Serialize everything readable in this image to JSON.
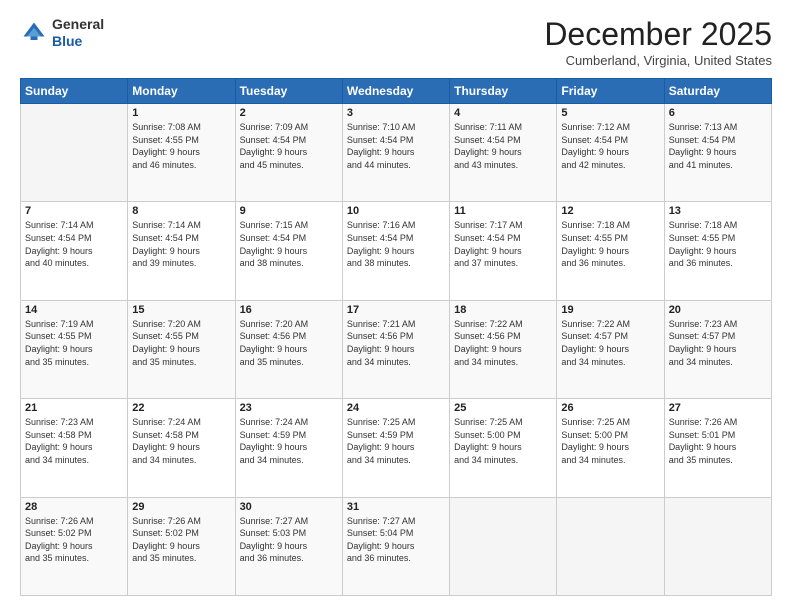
{
  "header": {
    "logo_general": "General",
    "logo_blue": "Blue",
    "month_title": "December 2025",
    "location": "Cumberland, Virginia, United States"
  },
  "weekdays": [
    "Sunday",
    "Monday",
    "Tuesday",
    "Wednesday",
    "Thursday",
    "Friday",
    "Saturday"
  ],
  "weeks": [
    [
      {
        "day": "",
        "info": ""
      },
      {
        "day": "1",
        "info": "Sunrise: 7:08 AM\nSunset: 4:55 PM\nDaylight: 9 hours\nand 46 minutes."
      },
      {
        "day": "2",
        "info": "Sunrise: 7:09 AM\nSunset: 4:54 PM\nDaylight: 9 hours\nand 45 minutes."
      },
      {
        "day": "3",
        "info": "Sunrise: 7:10 AM\nSunset: 4:54 PM\nDaylight: 9 hours\nand 44 minutes."
      },
      {
        "day": "4",
        "info": "Sunrise: 7:11 AM\nSunset: 4:54 PM\nDaylight: 9 hours\nand 43 minutes."
      },
      {
        "day": "5",
        "info": "Sunrise: 7:12 AM\nSunset: 4:54 PM\nDaylight: 9 hours\nand 42 minutes."
      },
      {
        "day": "6",
        "info": "Sunrise: 7:13 AM\nSunset: 4:54 PM\nDaylight: 9 hours\nand 41 minutes."
      }
    ],
    [
      {
        "day": "7",
        "info": "Sunrise: 7:14 AM\nSunset: 4:54 PM\nDaylight: 9 hours\nand 40 minutes."
      },
      {
        "day": "8",
        "info": "Sunrise: 7:14 AM\nSunset: 4:54 PM\nDaylight: 9 hours\nand 39 minutes."
      },
      {
        "day": "9",
        "info": "Sunrise: 7:15 AM\nSunset: 4:54 PM\nDaylight: 9 hours\nand 38 minutes."
      },
      {
        "day": "10",
        "info": "Sunrise: 7:16 AM\nSunset: 4:54 PM\nDaylight: 9 hours\nand 38 minutes."
      },
      {
        "day": "11",
        "info": "Sunrise: 7:17 AM\nSunset: 4:54 PM\nDaylight: 9 hours\nand 37 minutes."
      },
      {
        "day": "12",
        "info": "Sunrise: 7:18 AM\nSunset: 4:55 PM\nDaylight: 9 hours\nand 36 minutes."
      },
      {
        "day": "13",
        "info": "Sunrise: 7:18 AM\nSunset: 4:55 PM\nDaylight: 9 hours\nand 36 minutes."
      }
    ],
    [
      {
        "day": "14",
        "info": "Sunrise: 7:19 AM\nSunset: 4:55 PM\nDaylight: 9 hours\nand 35 minutes."
      },
      {
        "day": "15",
        "info": "Sunrise: 7:20 AM\nSunset: 4:55 PM\nDaylight: 9 hours\nand 35 minutes."
      },
      {
        "day": "16",
        "info": "Sunrise: 7:20 AM\nSunset: 4:56 PM\nDaylight: 9 hours\nand 35 minutes."
      },
      {
        "day": "17",
        "info": "Sunrise: 7:21 AM\nSunset: 4:56 PM\nDaylight: 9 hours\nand 34 minutes."
      },
      {
        "day": "18",
        "info": "Sunrise: 7:22 AM\nSunset: 4:56 PM\nDaylight: 9 hours\nand 34 minutes."
      },
      {
        "day": "19",
        "info": "Sunrise: 7:22 AM\nSunset: 4:57 PM\nDaylight: 9 hours\nand 34 minutes."
      },
      {
        "day": "20",
        "info": "Sunrise: 7:23 AM\nSunset: 4:57 PM\nDaylight: 9 hours\nand 34 minutes."
      }
    ],
    [
      {
        "day": "21",
        "info": "Sunrise: 7:23 AM\nSunset: 4:58 PM\nDaylight: 9 hours\nand 34 minutes."
      },
      {
        "day": "22",
        "info": "Sunrise: 7:24 AM\nSunset: 4:58 PM\nDaylight: 9 hours\nand 34 minutes."
      },
      {
        "day": "23",
        "info": "Sunrise: 7:24 AM\nSunset: 4:59 PM\nDaylight: 9 hours\nand 34 minutes."
      },
      {
        "day": "24",
        "info": "Sunrise: 7:25 AM\nSunset: 4:59 PM\nDaylight: 9 hours\nand 34 minutes."
      },
      {
        "day": "25",
        "info": "Sunrise: 7:25 AM\nSunset: 5:00 PM\nDaylight: 9 hours\nand 34 minutes."
      },
      {
        "day": "26",
        "info": "Sunrise: 7:25 AM\nSunset: 5:00 PM\nDaylight: 9 hours\nand 34 minutes."
      },
      {
        "day": "27",
        "info": "Sunrise: 7:26 AM\nSunset: 5:01 PM\nDaylight: 9 hours\nand 35 minutes."
      }
    ],
    [
      {
        "day": "28",
        "info": "Sunrise: 7:26 AM\nSunset: 5:02 PM\nDaylight: 9 hours\nand 35 minutes."
      },
      {
        "day": "29",
        "info": "Sunrise: 7:26 AM\nSunset: 5:02 PM\nDaylight: 9 hours\nand 35 minutes."
      },
      {
        "day": "30",
        "info": "Sunrise: 7:27 AM\nSunset: 5:03 PM\nDaylight: 9 hours\nand 36 minutes."
      },
      {
        "day": "31",
        "info": "Sunrise: 7:27 AM\nSunset: 5:04 PM\nDaylight: 9 hours\nand 36 minutes."
      },
      {
        "day": "",
        "info": ""
      },
      {
        "day": "",
        "info": ""
      },
      {
        "day": "",
        "info": ""
      }
    ]
  ]
}
